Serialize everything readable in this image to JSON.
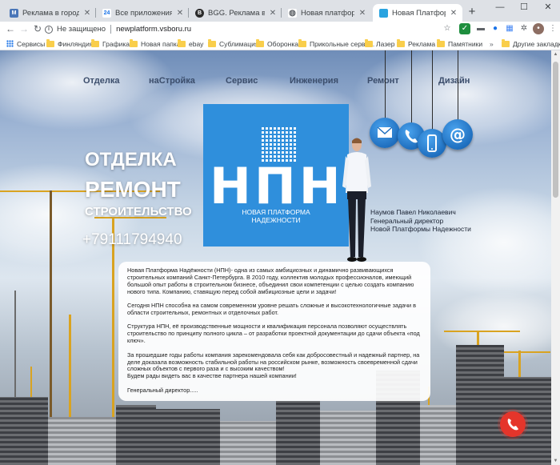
{
  "browser": {
    "tabs": [
      {
        "title": "Реклама в городе Сосновый",
        "favicon_text": "M",
        "favicon_color": "#4a76b8"
      },
      {
        "title": "Все приложения",
        "favicon_text": "24",
        "favicon_color": "#ffffff"
      },
      {
        "title": "BGG. Реклама в городе Со",
        "favicon_text": "B",
        "favicon_color": "#2b2b2b"
      },
      {
        "title": "Новая платформа надежн",
        "favicon_text": "◍",
        "favicon_color": "#5f6368"
      },
      {
        "title": "Новая Платформа Надежн",
        "favicon_text": "",
        "favicon_color": "#29a3e0"
      }
    ],
    "omnibox": {
      "security_label": "Не защищено",
      "url": "newplatform.vsboru.ru"
    },
    "bookmarks": [
      {
        "label": "Сервисы",
        "icon": "apps-grid-icon"
      },
      {
        "label": "Финляндия",
        "icon": "folder-icon"
      },
      {
        "label": "Графика",
        "icon": "folder-icon"
      },
      {
        "label": "Новая папка",
        "icon": "folder-icon"
      },
      {
        "label": "ebay",
        "icon": "folder-icon"
      },
      {
        "label": "Сублимация",
        "icon": "folder-icon"
      },
      {
        "label": "Оборонка",
        "icon": "folder-icon"
      },
      {
        "label": "Прикольные серви...",
        "icon": "folder-icon"
      },
      {
        "label": "Лазер",
        "icon": "folder-icon"
      },
      {
        "label": "Реклама",
        "icon": "folder-icon"
      },
      {
        "label": "Памятники",
        "icon": "folder-icon"
      }
    ],
    "other_bookmarks": "Другие закладки"
  },
  "site": {
    "nav": [
      "Отделка",
      "наСтройка",
      "Сервис",
      "Инженерия",
      "Ремонт",
      "Дизайн"
    ],
    "hero": {
      "line1": "ОТДЕЛКА",
      "line2": "РЕМОНТ",
      "line3": "СТРОИТЕЛЬСТВО",
      "phone": "+79111794940"
    },
    "logo": {
      "letters": "НПН",
      "subtitle_line1": "НОВАЯ ПЛАТФОРМА",
      "subtitle_line2": "НАДЕЖНОСТИ"
    },
    "person_caption": {
      "name": "Наумов Павел Николаевич",
      "role": "Генеральный директор",
      "company": "Новой Платформы Надежности"
    },
    "about": {
      "p1": "Новая Платформа Надёжности (НПН)- одна из самых амбициозных и динамично развивающихся строительных компаний Санкт-Петербурга. В 2010 году, коллектив молодых профессионалов, имеющий большой опыт работы в строительном бизнесе, объединил свои компетенции с целью создать компанию нового типа. Компанию, ставящую перед собой амбициозные цели и задачи!",
      "p2": "Сегодня НПН способна на самом современном уровне решать сложные и высокотехнологичные задачи в области строительных, ремонтных и отделочных работ.",
      "p3": "Структура НПН, её производственные мощности и квалификация персонала позволяют осуществлять строительство по принципу полного цикла – от разработки проектной документации до сдачи объекта «под ключ».",
      "p4": "За прошедшие годы работы компания зарекомендовала себя как добросовестный и надежный партнер, на деле доказала возможность стабильной работы на российском рынке, возможность своевременной сдачи сложных объектов с первого раза и с высоким качеством!",
      "p5": "Будем рады видеть вас в качестве партнера нашей компании!",
      "signature": "Генеральный директор....."
    },
    "contact_icons": [
      "mail-icon",
      "phone-icon",
      "mobile-icon",
      "at-sign-icon"
    ],
    "colors": {
      "logo_blue": "#2f8fdc",
      "icon_blue": "#1f6fbf",
      "call_red": "#e5352b",
      "nav_text": "#3b4d6b"
    }
  }
}
